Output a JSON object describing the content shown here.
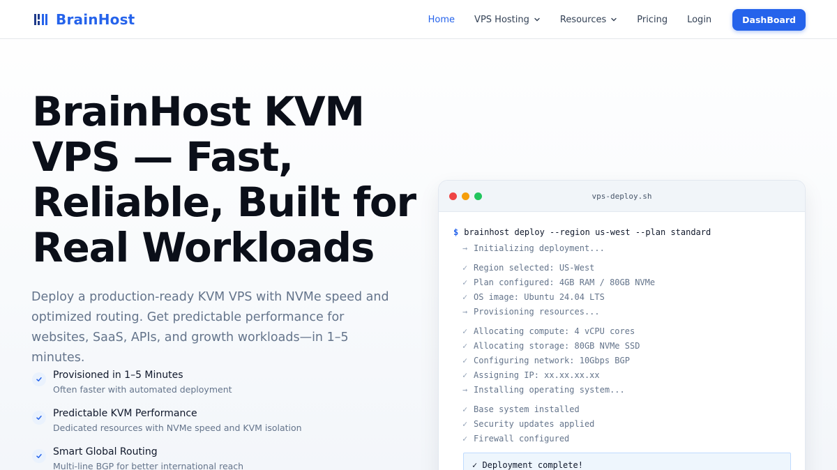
{
  "brand": {
    "name": "BrainHost"
  },
  "nav": {
    "links": [
      {
        "label": "Home",
        "active": true,
        "dropdown": false
      },
      {
        "label": "VPS Hosting",
        "active": false,
        "dropdown": true
      },
      {
        "label": "Resources",
        "active": false,
        "dropdown": true
      },
      {
        "label": "Pricing",
        "active": false,
        "dropdown": false
      },
      {
        "label": "Login",
        "active": false,
        "dropdown": false
      }
    ],
    "cta_label": "DashBoard"
  },
  "hero": {
    "title": "BrainHost KVM VPS — Fast, Reliable, Built for Real Workloads",
    "subtitle": "Deploy a production-ready KVM VPS with NVMe speed and optimized routing. Get predictable performance for websites, SaaS, APIs, and growth workloads—in 1–5 minutes.",
    "features": [
      {
        "title": "Provisioned in 1–5 Minutes",
        "desc": "Often faster with automated deployment"
      },
      {
        "title": "Predictable KVM Performance",
        "desc": "Dedicated resources with NVMe speed and KVM isolation"
      },
      {
        "title": "Smart Global Routing",
        "desc": "Multi-line BGP for better international reach"
      }
    ]
  },
  "terminal": {
    "filename": "vps-deploy.sh",
    "prompt": "$",
    "command": "brainhost deploy --region us-west --plan standard",
    "groups": [
      [
        {
          "mark": "→",
          "text": "Initializing deployment..."
        }
      ],
      [
        {
          "mark": "✓",
          "text": "Region selected: US-West"
        },
        {
          "mark": "✓",
          "text": "Plan configured: 4GB RAM / 80GB NVMe"
        },
        {
          "mark": "✓",
          "text": "OS image: Ubuntu 24.04 LTS"
        },
        {
          "mark": "→",
          "text": "Provisioning resources..."
        }
      ],
      [
        {
          "mark": "✓",
          "text": "Allocating compute: 4 vCPU cores"
        },
        {
          "mark": "✓",
          "text": "Allocating storage: 80GB NVMe SSD"
        },
        {
          "mark": "✓",
          "text": "Configuring network: 10Gbps BGP"
        },
        {
          "mark": "✓",
          "text": "Assigning IP: xx.xx.xx.xx"
        },
        {
          "mark": "→",
          "text": "Installing operating system..."
        }
      ],
      [
        {
          "mark": "✓",
          "text": "Base system installed"
        },
        {
          "mark": "✓",
          "text": "Security updates applied"
        },
        {
          "mark": "✓",
          "text": "Firewall configured"
        }
      ]
    ],
    "done": "✓ Deployment complete!"
  },
  "colors": {
    "accent": "#2563eb",
    "dark": "#0b0f19",
    "muted": "#64748b"
  }
}
